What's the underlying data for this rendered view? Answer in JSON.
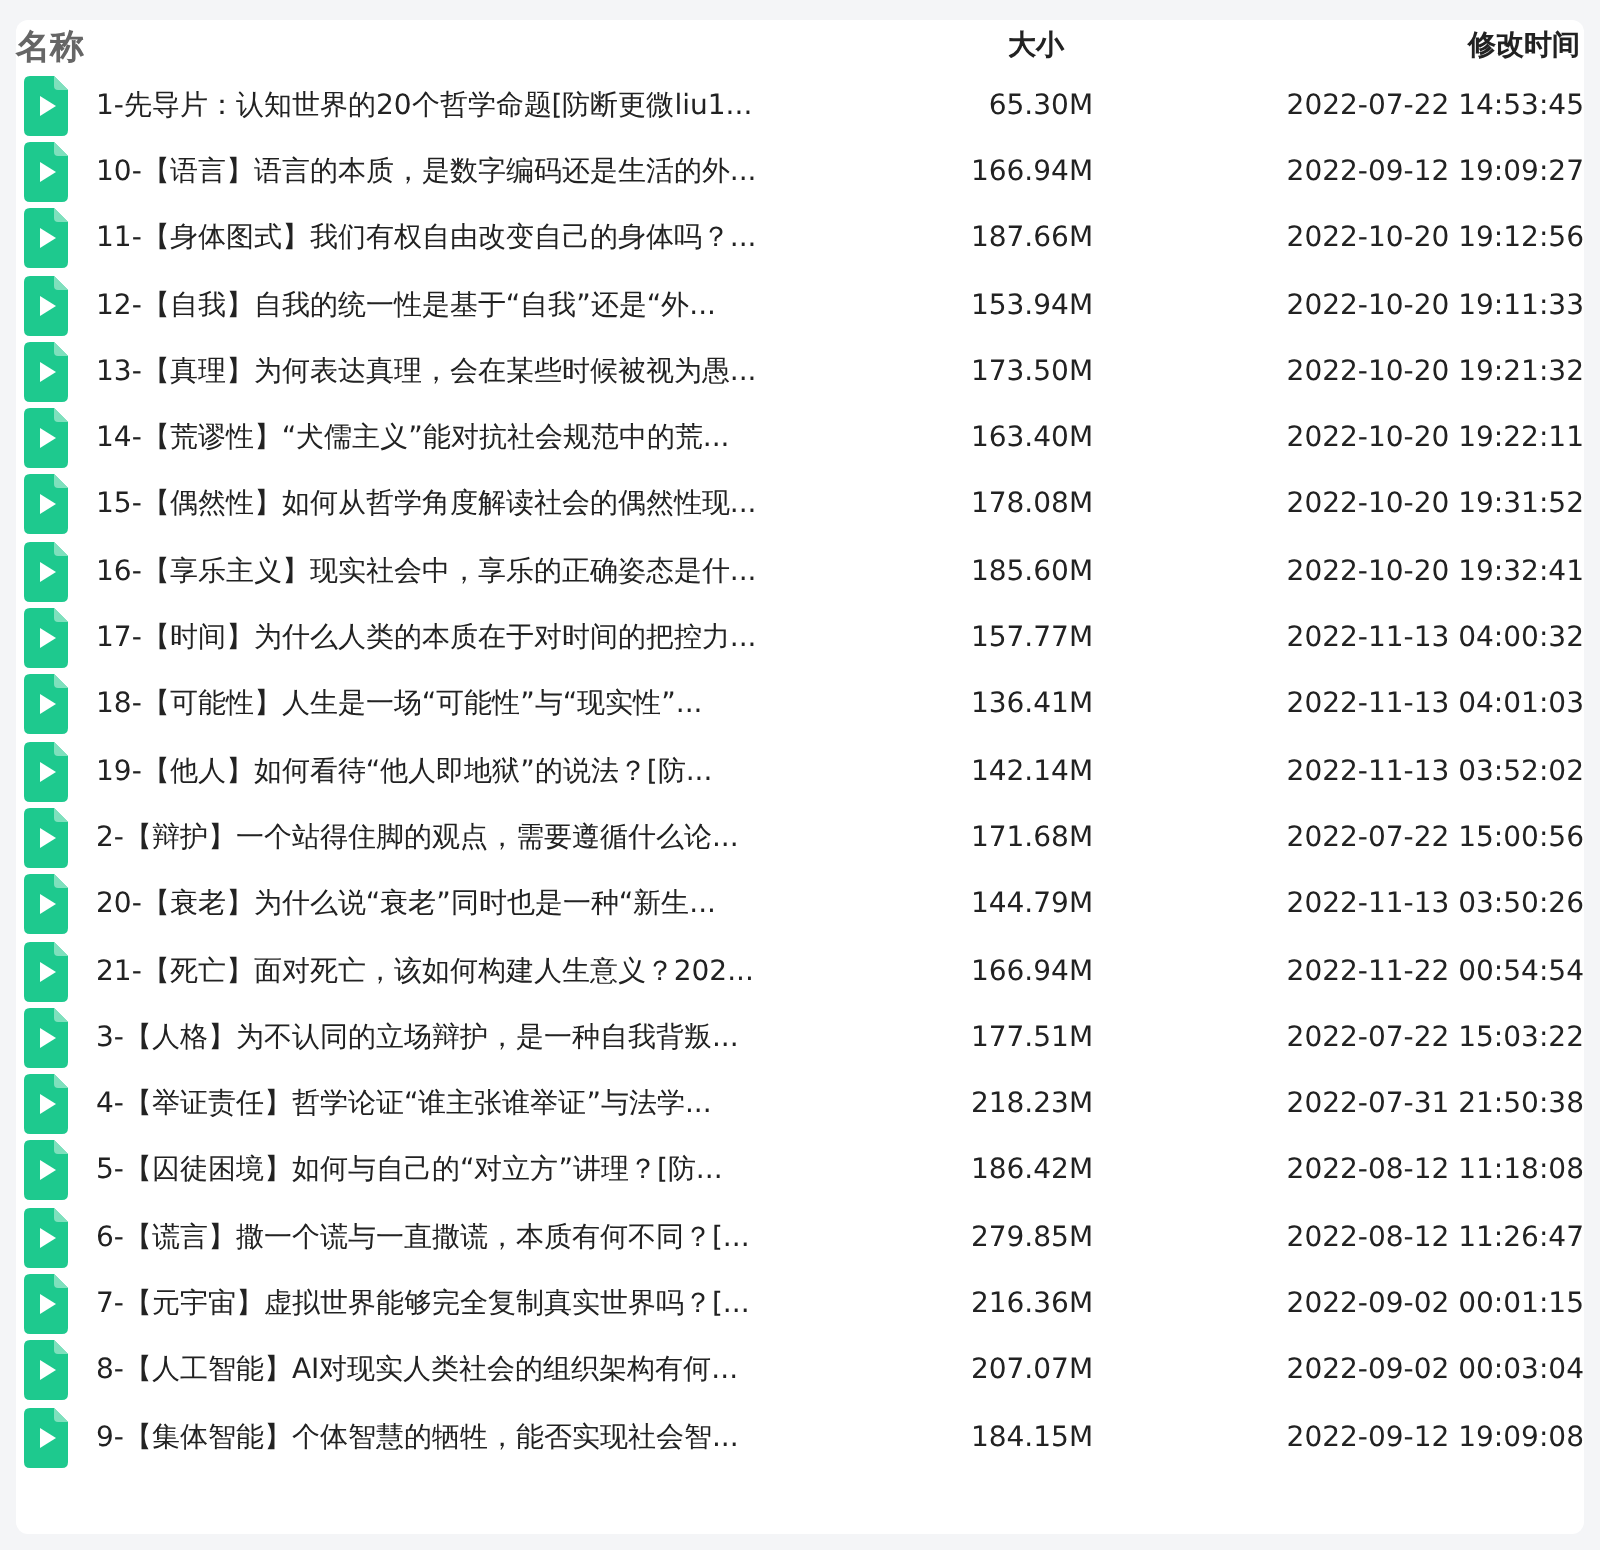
{
  "columns": [
    "名称",
    "大小",
    "修改时间"
  ],
  "rows": [
    {
      "name": "1-先导片：认知世界的20个哲学命题[防断更微liu1...",
      "size": "65.30M",
      "modified": "2022-07-22 14:53:45"
    },
    {
      "name": "10-【语言】语言的本质，是数字编码还是生活的外...",
      "size": "166.94M",
      "modified": "2022-09-12 19:09:27"
    },
    {
      "name": "11-【身体图式】我们有权自由改变自己的身体吗？...",
      "size": "187.66M",
      "modified": "2022-10-20 19:12:56"
    },
    {
      "name": "12-【自我】自我的统一性是基于“自我”还是“外...",
      "size": "153.94M",
      "modified": "2022-10-20 19:11:33"
    },
    {
      "name": "13-【真理】为何表达真理，会在某些时候被视为愚...",
      "size": "173.50M",
      "modified": "2022-10-20 19:21:32"
    },
    {
      "name": "14-【荒谬性】“犬儒主义”能对抗社会规范中的荒...",
      "size": "163.40M",
      "modified": "2022-10-20 19:22:11"
    },
    {
      "name": "15-【偶然性】如何从哲学角度解读社会的偶然性现...",
      "size": "178.08M",
      "modified": "2022-10-20 19:31:52"
    },
    {
      "name": "16-【享乐主义】现实社会中，享乐的正确姿态是什...",
      "size": "185.60M",
      "modified": "2022-10-20 19:32:41"
    },
    {
      "name": "17-【时间】为什么人类的本质在于对时间的把控力...",
      "size": "157.77M",
      "modified": "2022-11-13 04:00:32"
    },
    {
      "name": "18-【可能性】人生是一场“可能性”与“现实性”...",
      "size": "136.41M",
      "modified": "2022-11-13 04:01:03"
    },
    {
      "name": "19-【他人】如何看待“他人即地狱”的说法？[防...",
      "size": "142.14M",
      "modified": "2022-11-13 03:52:02"
    },
    {
      "name": "2-【辩护】一个站得住脚的观点，需要遵循什么论...",
      "size": "171.68M",
      "modified": "2022-07-22 15:00:56"
    },
    {
      "name": "20-【衰老】为什么说“衰老”同时也是一种“新生...",
      "size": "144.79M",
      "modified": "2022-11-13 03:50:26"
    },
    {
      "name": "21-【死亡】面对死亡，该如何构建人生意义？202...",
      "size": "166.94M",
      "modified": "2022-11-22 00:54:54"
    },
    {
      "name": "3-【人格】为不认同的立场辩护，是一种自我背叛...",
      "size": "177.51M",
      "modified": "2022-07-22 15:03:22"
    },
    {
      "name": "4-【举证责任】哲学论证“谁主张谁举证”与法学...",
      "size": "218.23M",
      "modified": "2022-07-31 21:50:38"
    },
    {
      "name": "5-【囚徒困境】如何与自己的“对立方”讲理？[防...",
      "size": "186.42M",
      "modified": "2022-08-12 11:18:08"
    },
    {
      "name": "6-【谎言】撒一个谎与一直撒谎，本质有何不同？[...",
      "size": "279.85M",
      "modified": "2022-08-12 11:26:47"
    },
    {
      "name": "7-【元宇宙】虚拟世界能够完全复制真实世界吗？[...",
      "size": "216.36M",
      "modified": "2022-09-02 00:01:15"
    },
    {
      "name": "8-【人工智能】AI对现实人类社会的组织架构有何...",
      "size": "207.07M",
      "modified": "2022-09-02 00:03:04"
    },
    {
      "name": "9-【集体智能】个体智慧的牺牲，能否实现社会智...",
      "size": "184.15M",
      "modified": "2022-09-12 19:09:08"
    }
  ]
}
